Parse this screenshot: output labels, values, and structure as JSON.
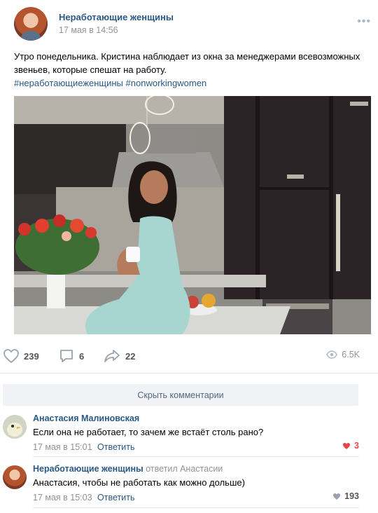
{
  "post": {
    "author": "Неработающие женщины",
    "date": "17 мая в 14:56",
    "more": "•••",
    "text": "Утро понедельника. Кристина наблюдает из окна за менеджерами всевозможных звеньев, которые спешат на работу.",
    "hashtags": [
      "#неработающиеженщины",
      "#nonworkingwomen"
    ]
  },
  "actions": {
    "likes": "239",
    "comments": "6",
    "shares": "22",
    "views": "6.5K"
  },
  "hide_comments_label": "Скрыть комментарии",
  "comments": [
    {
      "author": "Анастасия Малиновская",
      "reply_to": "",
      "text": "Если она не работает, то зачем же встаёт столь рано?",
      "date": "17 мая в 15:01",
      "reply_label": "Ответить",
      "likes": "3",
      "liked": true
    },
    {
      "author": "Неработающие женщины",
      "reply_to": "ответил Анастасии",
      "text": "Анастасия, чтобы не работать как можно дольше)",
      "date": "17 мая в 15:03",
      "reply_label": "Ответить",
      "likes": "193",
      "liked": false
    }
  ],
  "colors": {
    "link": "#2a5885",
    "meta": "#939393",
    "like_active": "#e64646",
    "divider": "#e7e8ec"
  },
  "icons": [
    "more-icon",
    "heart-icon",
    "comment-icon",
    "share-icon",
    "eye-icon"
  ]
}
